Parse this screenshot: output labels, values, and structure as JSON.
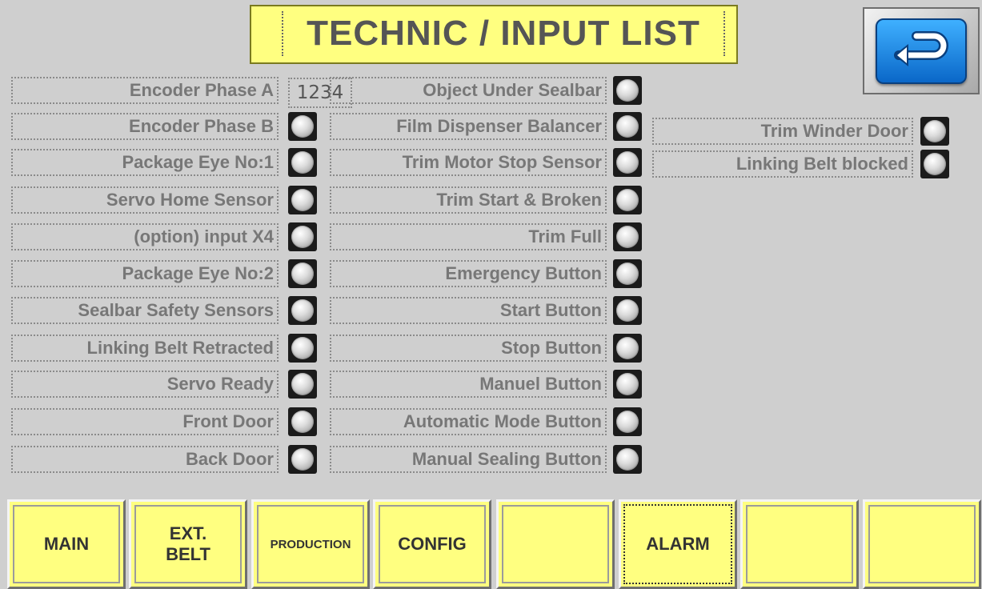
{
  "title": "TECHNIC / INPUT LIST",
  "back_button": {
    "icon": "return-arrow-icon",
    "color": "#1a8ae8"
  },
  "encoder_value": "1234",
  "inputs_col1": [
    "Encoder Phase A",
    "Encoder Phase B",
    "Package Eye No:1",
    "Servo Home Sensor",
    "(option) input X4",
    "Package Eye No:2",
    "Sealbar Safety Sensors",
    "Linking Belt Retracted",
    "Servo Ready",
    "Front Door",
    "Back Door"
  ],
  "inputs_col2": [
    "Object Under Sealbar",
    "Film Dispenser Balancer",
    "Trim Motor Stop Sensor",
    "Trim Start & Broken",
    "Trim Full",
    "Emergency Button",
    "Start Button",
    "Stop Button",
    "Manuel Button",
    "Automatic Mode Button",
    "Manual Sealing Button"
  ],
  "inputs_col3": [
    "Trim Winder Door",
    "Linking Belt blocked"
  ],
  "nav": [
    {
      "label": "MAIN"
    },
    {
      "label": "EXT.\nBELT"
    },
    {
      "label": "PRODUCTION"
    },
    {
      "label": "CONFIG"
    },
    {
      "label": ""
    },
    {
      "label": "ALARM"
    },
    {
      "label": ""
    },
    {
      "label": ""
    }
  ],
  "colors": {
    "background": "#cfcfcf",
    "button_yellow": "#ffff80",
    "label_text": "#777777"
  }
}
